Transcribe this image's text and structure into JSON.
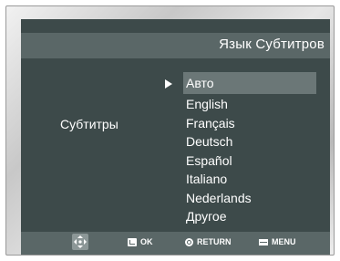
{
  "header": {
    "title": "Язык Субтитров"
  },
  "main": {
    "label": "Субтитры",
    "selected_index": 0,
    "options": [
      "Авто",
      "English",
      "Français",
      "Deutsch",
      "Español",
      "Italiano",
      "Nederlands",
      "Другое"
    ]
  },
  "footer": {
    "ok_label": "OK",
    "return_label": "RETURN",
    "menu_label": "MENU"
  },
  "icons": {
    "navigate": "dpad-navigation-icon",
    "ok": "ok-enter-icon",
    "return": "return-icon",
    "menu": "menu-icon"
  },
  "colors": {
    "screen_bg": "#3d4a4a",
    "bar_bg": "#5a6767",
    "highlight": "#6b7777",
    "text": "#ffffff"
  }
}
